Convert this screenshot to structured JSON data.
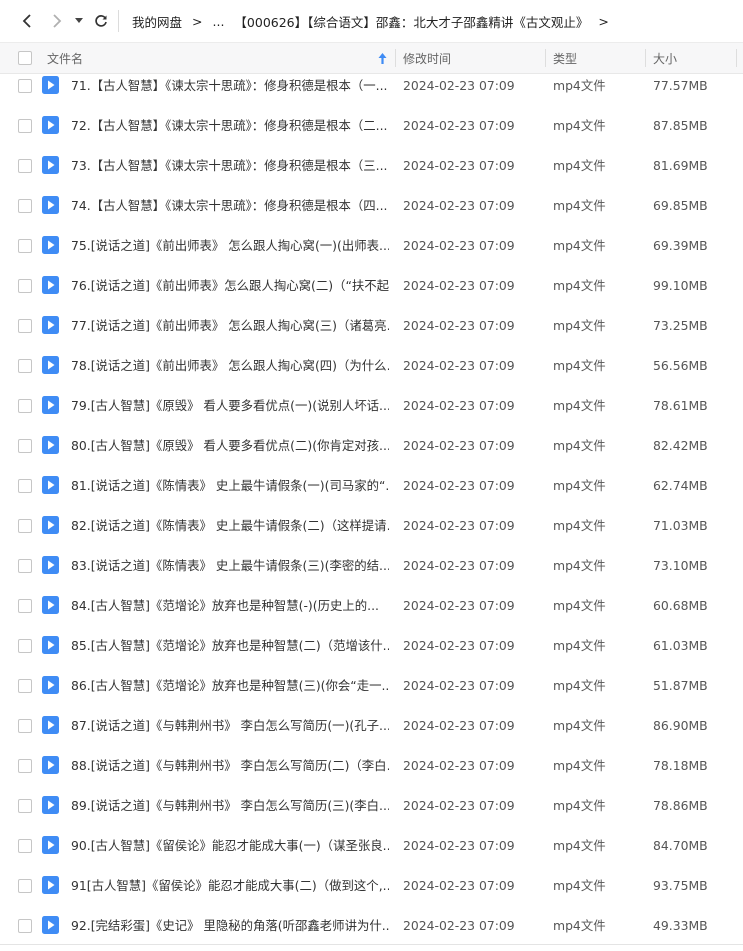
{
  "breadcrumb": [
    "我的网盘",
    ">",
    "...",
    "【000626】【综合语文】邵鑫：北大才子邵鑫精讲《古文观止》",
    ">"
  ],
  "columns": {
    "name": "文件名",
    "modified": "修改时间",
    "type": "类型",
    "size": "大小"
  },
  "rows": [
    {
      "name": "71.【古人智慧】《谏太宗十思疏》：修身积德是根本（一...",
      "time": "2024-02-23 07:09",
      "type": "mp4文件",
      "size": "77.57MB"
    },
    {
      "name": "72.【古人智慧】《谏太宗十思疏》：修身积德是根本（二...",
      "time": "2024-02-23 07:09",
      "type": "mp4文件",
      "size": "87.85MB"
    },
    {
      "name": "73.【古人智慧】《谏太宗十思疏》：修身积德是根本（三...",
      "time": "2024-02-23 07:09",
      "type": "mp4文件",
      "size": "81.69MB"
    },
    {
      "name": "74.【古人智慧】《谏太宗十思疏》：修身积德是根本（四...",
      "time": "2024-02-23 07:09",
      "type": "mp4文件",
      "size": "69.85MB"
    },
    {
      "name": "75.[说话之道]《前出师表》 怎么跟人掏心窝(一)(出师表...",
      "time": "2024-02-23 07:09",
      "type": "mp4文件",
      "size": "69.39MB"
    },
    {
      "name": "76.[说话之道]《前出师表》怎么跟人掏心窝(二)（“扶不起...",
      "time": "2024-02-23 07:09",
      "type": "mp4文件",
      "size": "99.10MB"
    },
    {
      "name": "77.[说话之道]《前出师表》 怎么跟人掏心窝(三)（诸葛亮...",
      "time": "2024-02-23 07:09",
      "type": "mp4文件",
      "size": "73.25MB"
    },
    {
      "name": "78.[说话之道]《前出师表》 怎么跟人掏心窝(四)（为什么...",
      "time": "2024-02-23 07:09",
      "type": "mp4文件",
      "size": "56.56MB"
    },
    {
      "name": "79.[古人智慧]《原毁》 看人要多看优点(一)(说别人坏话...",
      "time": "2024-02-23 07:09",
      "type": "mp4文件",
      "size": "78.61MB"
    },
    {
      "name": "80.[古人智慧]《原毁》 看人要多看优点(二)(你肯定对孩...",
      "time": "2024-02-23 07:09",
      "type": "mp4文件",
      "size": "82.42MB"
    },
    {
      "name": "81.[说话之道]《陈情表》 史上最牛请假条(一)(司马家的“...",
      "time": "2024-02-23 07:09",
      "type": "mp4文件",
      "size": "62.74MB"
    },
    {
      "name": "82.[说话之道]《陈情表》 史上最牛请假条(二)（这样提请...",
      "time": "2024-02-23 07:09",
      "type": "mp4文件",
      "size": "71.03MB"
    },
    {
      "name": "83.[说话之道]《陈情表》 史上最牛请假条(三)(李密的结...",
      "time": "2024-02-23 07:09",
      "type": "mp4文件",
      "size": "73.10MB"
    },
    {
      "name": "84.[古人智慧]《范增论》放弃也是种智慧(-)(历史上的...",
      "time": "2024-02-23 07:09",
      "type": "mp4文件",
      "size": "60.68MB"
    },
    {
      "name": "85.[古人智慧]《范增论》放弃也是种智慧(二)（范增该什...",
      "time": "2024-02-23 07:09",
      "type": "mp4文件",
      "size": "61.03MB"
    },
    {
      "name": "86.[古人智慧]《范增论》放弃也是种智慧(三)(你会“走一...",
      "time": "2024-02-23 07:09",
      "type": "mp4文件",
      "size": "51.87MB"
    },
    {
      "name": "87.[说话之道]《与韩荆州书》 李白怎么写简历(一)(孔子...",
      "time": "2024-02-23 07:09",
      "type": "mp4文件",
      "size": "86.90MB"
    },
    {
      "name": "88.[说话之道]《与韩荆州书》 李白怎么写简历(二)（李白...",
      "time": "2024-02-23 07:09",
      "type": "mp4文件",
      "size": "78.18MB"
    },
    {
      "name": "89.[说话之道]《与韩荆州书》 李白怎么写简历(三)(李白...",
      "time": "2024-02-23 07:09",
      "type": "mp4文件",
      "size": "78.86MB"
    },
    {
      "name": "90.[古人智慧]《留侯论》能忍才能成大事(一)（谋圣张良...",
      "time": "2024-02-23 07:09",
      "type": "mp4文件",
      "size": "84.70MB"
    },
    {
      "name": "91[古人智慧]《留侯论》能忍才能成大事(二)（做到这个,...",
      "time": "2024-02-23 07:09",
      "type": "mp4文件",
      "size": "93.75MB"
    },
    {
      "name": "92.[完结彩蛋]《史记》 里隐秘的角落(听邵鑫老师讲为什...",
      "time": "2024-02-23 07:09",
      "type": "mp4文件",
      "size": "49.33MB"
    }
  ],
  "icons": {
    "back": "arrow-left-icon",
    "forward": "arrow-right-icon",
    "dropdown": "chevron-down-icon",
    "refresh": "refresh-icon",
    "sort": "sort-asc-icon",
    "file": "video-file-icon"
  },
  "colors": {
    "accent": "#3f8cf5",
    "sort_arrow": "#3f8cf5"
  }
}
